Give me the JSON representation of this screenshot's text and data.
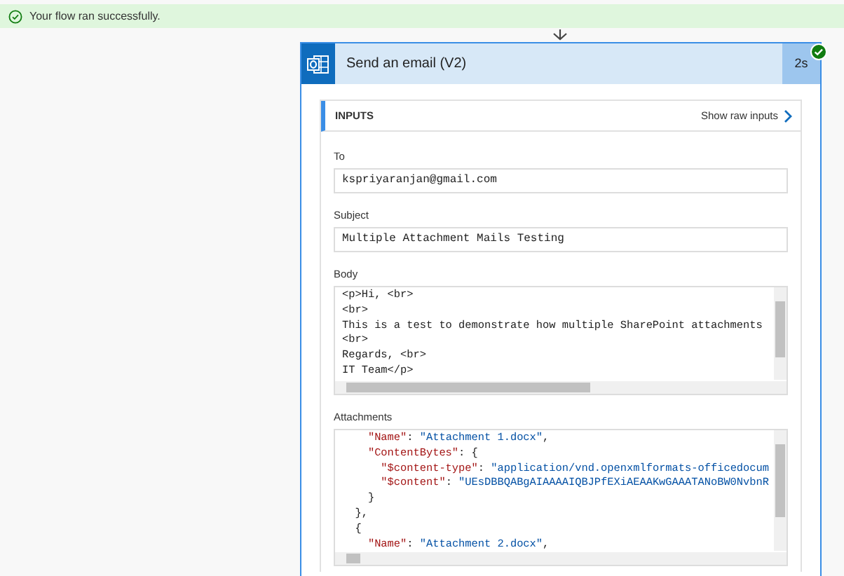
{
  "banner": {
    "text": "Your flow ran successfully."
  },
  "action": {
    "title": "Send an email (V2)",
    "duration": "2s",
    "succeeded": true
  },
  "inputs": {
    "heading": "INPUTS",
    "raw_link": "Show raw inputs",
    "fields": [
      {
        "label": "To",
        "value": "kspriyaranjan@gmail.com"
      },
      {
        "label": "Subject",
        "value": "Multiple Attachment Mails Testing"
      }
    ],
    "body": {
      "label": "Body",
      "lines": [
        "<p>Hi, <br>",
        "<br>",
        "This is a test to demonstrate how multiple SharePoint attachments",
        "<br>",
        "Regards, <br>",
        "IT Team</p>"
      ]
    },
    "attachments": {
      "label": "Attachments",
      "lines": [
        [
          {
            "kind": "key",
            "text": "    \"Name\""
          },
          {
            "kind": "punct",
            "text": ": "
          },
          {
            "kind": "string",
            "text": "\"Attachment 1.docx\""
          },
          {
            "kind": "punct",
            "text": ","
          }
        ],
        [
          {
            "kind": "key",
            "text": "    \"ContentBytes\""
          },
          {
            "kind": "punct",
            "text": ": {"
          }
        ],
        [
          {
            "kind": "key",
            "text": "      \"$content-type\""
          },
          {
            "kind": "punct",
            "text": ": "
          },
          {
            "kind": "string",
            "text": "\"application/vnd.openxmlformats-officedocum"
          }
        ],
        [
          {
            "kind": "key",
            "text": "      \"$content\""
          },
          {
            "kind": "punct",
            "text": ": "
          },
          {
            "kind": "string",
            "text": "\"UEsDBBQABgAIAAAAIQBJPfEXiAEAAKwGAAATANoBW0NvbnR"
          }
        ],
        [
          {
            "kind": "punct",
            "text": "    }"
          }
        ],
        [
          {
            "kind": "punct",
            "text": "  },"
          }
        ],
        [
          {
            "kind": "punct",
            "text": "  {"
          }
        ],
        [
          {
            "kind": "key",
            "text": "    \"Name\""
          },
          {
            "kind": "punct",
            "text": ": "
          },
          {
            "kind": "string",
            "text": "\"Attachment 2.docx\""
          },
          {
            "kind": "punct",
            "text": ","
          }
        ]
      ]
    }
  }
}
